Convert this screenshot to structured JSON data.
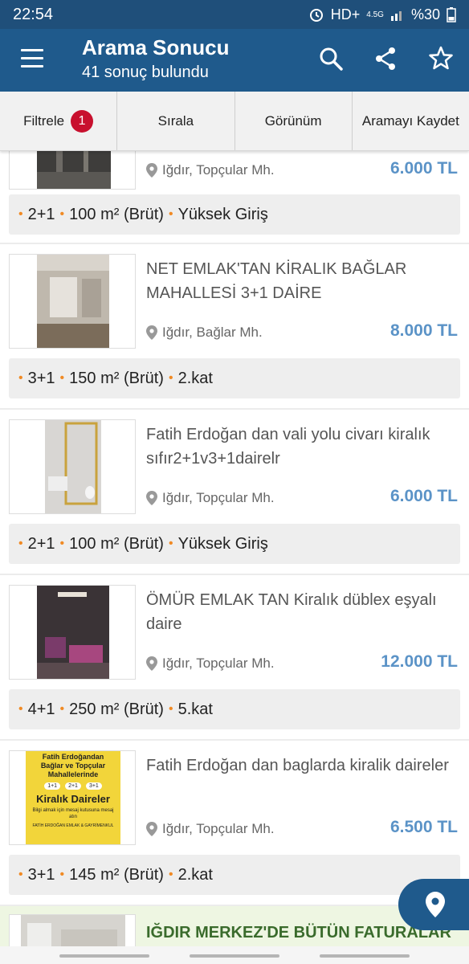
{
  "status": {
    "time": "22:54",
    "network": "HD+",
    "network_sub": "4.5G",
    "battery": "%30"
  },
  "header": {
    "title": "Arama Sonucu",
    "subtitle": "41 sonuç bulundu"
  },
  "toolbar": {
    "filter_label": "Filtrele",
    "filter_count": "1",
    "sort_label": "Sırala",
    "view_label": "Görünüm",
    "save_search_label": "Aramayı Kaydet"
  },
  "listings": [
    {
      "title": "",
      "location": "Iğdır, Topçular Mh.",
      "price": "6.000 TL",
      "rooms": "2+1",
      "area": "100 m² (Brüt)",
      "floor": "Yüksek Giriş"
    },
    {
      "title": "NET EMLAK'TAN KİRALIK BAĞLAR MAHALLESİ 3+1 DAİRE",
      "location": "Iğdır, Bağlar Mh.",
      "price": "8.000 TL",
      "rooms": "3+1",
      "area": "150 m² (Brüt)",
      "floor": "2.kat"
    },
    {
      "title": "Fatih Erdoğan dan vali yolu civarı kiralık sıfır2+1v3+1dairelr",
      "location": "Iğdır, Topçular Mh.",
      "price": "6.000 TL",
      "rooms": "2+1",
      "area": "100 m² (Brüt)",
      "floor": "Yüksek Giriş"
    },
    {
      "title": "ÖMÜR EMLAK TAN Kiralık düblex eşyalı daire",
      "location": "Iğdır, Topçular Mh.",
      "price": "12.000 TL",
      "rooms": "4+1",
      "area": "250 m² (Brüt)",
      "floor": "5.kat"
    },
    {
      "title": "Fatih Erdoğan dan baglarda kiralik daireler",
      "location": "Iğdır, Topçular Mh.",
      "price": "6.500 TL",
      "rooms": "3+1",
      "area": "145 m² (Brüt)",
      "floor": "2.kat"
    },
    {
      "title": "IĞDIR MERKEZ'DE BÜTÜN FATURALAR"
    }
  ],
  "poster": {
    "line1": "Fatih Erdoğandan",
    "line2": "Bağlar ve Topçular",
    "line3": "Mahallelerinde",
    "opt1": "1+1",
    "opt2": "2+1",
    "opt3": "3+1",
    "headline": "Kiralık Daireler",
    "note": "Bilgi almak için mesaj kutusuna mesaj atın",
    "footer": "FATİH ERDOĞAN EMLAK & GAYRİMENKUL"
  }
}
